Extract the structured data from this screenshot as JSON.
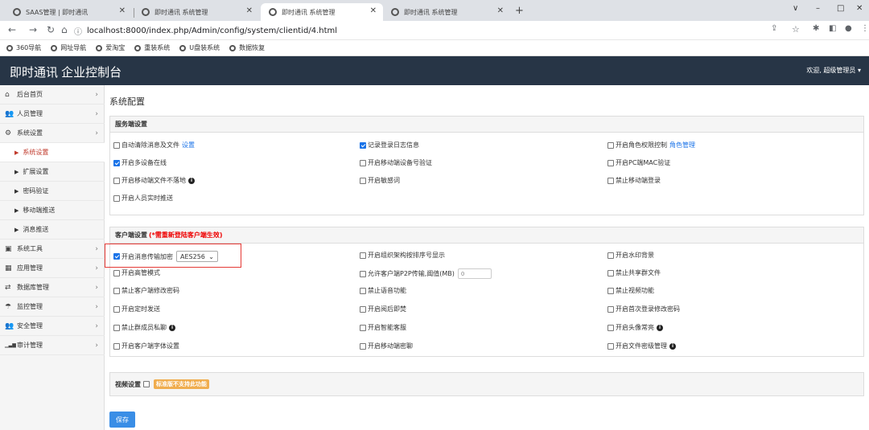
{
  "browser": {
    "tabs": [
      {
        "label": "SAAS管理 | 即时通讯"
      },
      {
        "label": "即时通讯 系统管理"
      },
      {
        "label": "即时通讯 系统管理"
      },
      {
        "label": "即时通讯 系统管理"
      }
    ],
    "new_tab": "+",
    "window_controls": [
      "∨",
      "–",
      "□",
      "✕"
    ],
    "url": "localhost:8000/index.php/Admin/config/system/clientid/4.html",
    "bookmarks": [
      "360导航",
      "网址导航",
      "爱淘宝",
      "重装系统",
      "U盘装系统",
      "数据恢复"
    ]
  },
  "app": {
    "brand": "即时通讯 企业控制台",
    "welcome": "欢迎, 超级管理员 ▾"
  },
  "sidebar": {
    "items": [
      {
        "label": "后台首页",
        "icon": "home-icon",
        "glyph": "⌂"
      },
      {
        "label": "人员管理",
        "icon": "users-icon",
        "glyph": "👥"
      },
      {
        "label": "系统设置",
        "icon": "cogs-icon",
        "glyph": "⚙"
      },
      {
        "label": "系统设置",
        "sub": true
      },
      {
        "label": "扩展设置",
        "sub": true
      },
      {
        "label": "密码验证",
        "sub": true
      },
      {
        "label": "移动端推送",
        "sub": true
      },
      {
        "label": "消息推送",
        "sub": true
      },
      {
        "label": "系统工具",
        "icon": "briefcase-icon",
        "glyph": "▣"
      },
      {
        "label": "应用管理",
        "icon": "grid-icon",
        "glyph": "▦"
      },
      {
        "label": "数据库管理",
        "icon": "retweet-icon",
        "glyph": "⇄"
      },
      {
        "label": "监控管理",
        "icon": "umbrella-icon",
        "glyph": "☂"
      },
      {
        "label": "安全管理",
        "icon": "users-icon",
        "glyph": "👥"
      },
      {
        "label": "审计管理",
        "icon": "bar-chart-icon",
        "glyph": "▁▃▆"
      }
    ]
  },
  "main": {
    "title": "系统配置",
    "server_panel": {
      "heading": "服务端设置",
      "options": [
        {
          "label": "自动清除消息及文件",
          "checked": false,
          "link": "设置"
        },
        {
          "label": "记录登录日志信息",
          "checked": true
        },
        {
          "label": "开启角色权限控制",
          "checked": false,
          "link": "角色管理"
        },
        {
          "label": "开启多设备在线",
          "checked": true
        },
        {
          "label": "开启移动端设备号验证",
          "checked": false
        },
        {
          "label": "开启PC端MAC验证",
          "checked": false
        },
        {
          "label": "开启移动端文件不落地",
          "checked": false,
          "info": true
        },
        {
          "label": "开启敏感词",
          "checked": false
        },
        {
          "label": "禁止移动端登录",
          "checked": false
        },
        {
          "label": "开启人员实时推送",
          "checked": false
        }
      ]
    },
    "client_panel": {
      "heading": "客户端设置",
      "note": "(*需重新登陆客户端生效)",
      "encrypt_value": "AES256",
      "p2p_value": "0",
      "options": [
        {
          "label": "开启消息传输加密",
          "checked": true
        },
        {
          "label": "开启组织架构按排序号显示",
          "checked": false
        },
        {
          "label": "开启水印背景",
          "checked": false
        },
        {
          "label": "开启高管模式",
          "checked": false
        },
        {
          "label": "允许客户端P2P传输,阈值(MB)",
          "checked": false
        },
        {
          "label": "禁止共享群文件",
          "checked": false
        },
        {
          "label": "禁止客户端修改密码",
          "checked": false
        },
        {
          "label": "禁止语音功能",
          "checked": false
        },
        {
          "label": "禁止视频功能",
          "checked": false
        },
        {
          "label": "开启定时发送",
          "checked": false
        },
        {
          "label": "开启阅后即焚",
          "checked": false
        },
        {
          "label": "开启首次登录修改密码",
          "checked": false
        },
        {
          "label": "禁止群成员私聊",
          "checked": false,
          "info": true
        },
        {
          "label": "开启智能客服",
          "checked": false
        },
        {
          "label": "开启头像常亮",
          "checked": false,
          "info": true
        },
        {
          "label": "开启客户端字体设置",
          "checked": false
        },
        {
          "label": "开启移动端密聊",
          "checked": false
        },
        {
          "label": "开启文件密级管理",
          "checked": false,
          "info": true
        }
      ]
    },
    "video_panel": {
      "heading": "视频设置",
      "badge": "标准版不支持此功能"
    },
    "save_label": "保存"
  },
  "colors": {
    "topbar": "#273546",
    "accent": "#1a73e8",
    "highlight": "#e53935",
    "badge": "#f0ad4e"
  }
}
